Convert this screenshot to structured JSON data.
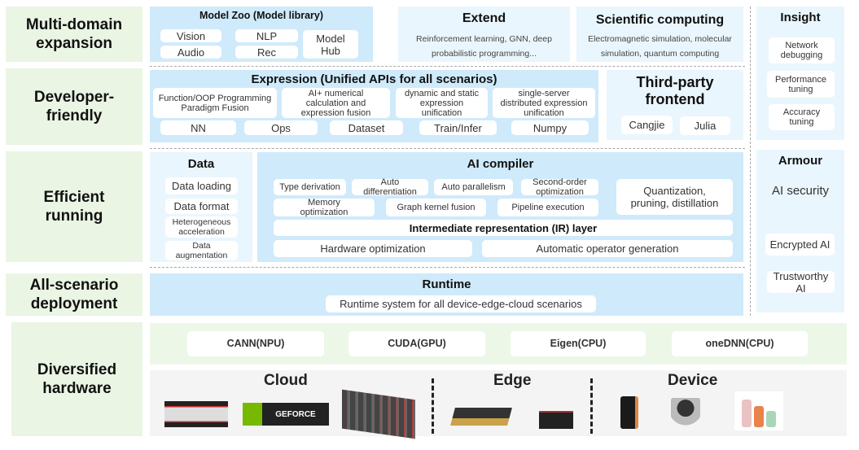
{
  "layers": {
    "multi_domain": "Multi-domain expansion",
    "developer": "Developer-friendly",
    "efficient": "Efficient running",
    "all_scenario": "All-scenario deployment",
    "hardware": "Diversified hardware"
  },
  "model_zoo": {
    "title": "Model Zoo (Model library)",
    "items": [
      "Vision",
      "NLP",
      "Audio",
      "Rec",
      "Model Hub"
    ]
  },
  "extend": {
    "title": "Extend",
    "desc": "Reinforcement learning, GNN, deep probabilistic programming..."
  },
  "scientific": {
    "title": "Scientific computing",
    "desc": "Electromagnetic simulation, molecular simulation, quantum computing"
  },
  "expression": {
    "title": "Expression (Unified APIs for all scenarios)",
    "features": [
      "Function/OOP Programming Paradigm Fusion",
      "AI+ numerical calculation and expression fusion",
      "dynamic and static expression unification",
      "single-server distributed expression unification"
    ],
    "modules": [
      "NN",
      "Ops",
      "Dataset",
      "Train/Infer",
      "Numpy"
    ]
  },
  "third_party": {
    "title": "Third-party frontend",
    "items": [
      "Cangjie",
      "Julia"
    ]
  },
  "data": {
    "title": "Data",
    "items": [
      "Data loading",
      "Data format",
      "Heterogeneous acceleration",
      "Data augmentation"
    ]
  },
  "ai_compiler": {
    "title": "AI compiler",
    "row1": [
      "Type derivation",
      "Auto differentiation",
      "Auto parallelism",
      "Second-order optimization"
    ],
    "row2": [
      "Memory optimization",
      "Graph kernel fusion",
      "Pipeline execution"
    ],
    "quant": "Quantization, pruning, distillation",
    "ir": "Intermediate representation (IR) layer",
    "hw_opt": "Hardware optimization",
    "auto_op": "Automatic operator generation"
  },
  "runtime": {
    "title": "Runtime",
    "desc": "Runtime system for all device-edge-cloud scenarios"
  },
  "insight": {
    "title": "Insight",
    "items": [
      "Network debugging",
      "Performance tuning",
      "Accuracy tuning"
    ]
  },
  "armour": {
    "title": "Armour",
    "security": "AI security",
    "items": [
      "Encrypted AI",
      "Trustworthy AI"
    ]
  },
  "backends": [
    "CANN(NPU)",
    "CUDA(GPU)",
    "Eigen(CPU)",
    "oneDNN(CPU)"
  ],
  "hardware": {
    "cloud": "Cloud",
    "edge": "Edge",
    "device": "Device",
    "geforce_logo": "GEFORCE"
  }
}
